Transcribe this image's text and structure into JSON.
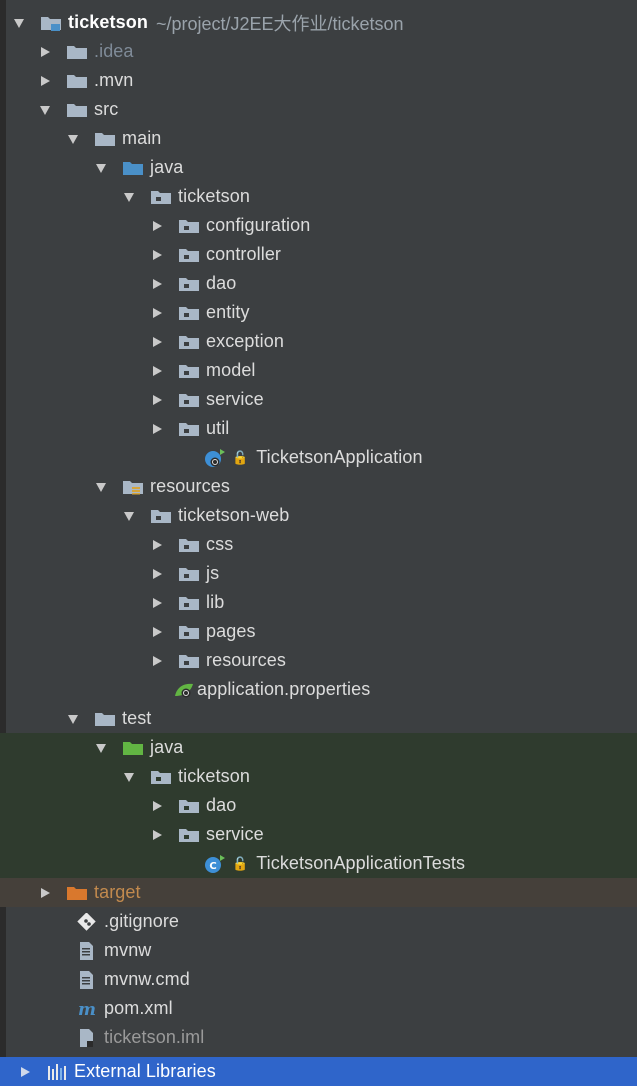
{
  "project": {
    "name": "ticketson",
    "path": "~/project/J2EE大作业/ticketson"
  },
  "tree": {
    "idea": ".idea",
    "mvn": ".mvn",
    "src": "src",
    "main": "main",
    "main_java": "java",
    "main_pkg": "ticketson",
    "configuration": "configuration",
    "controller": "controller",
    "dao": "dao",
    "entity": "entity",
    "exception": "exception",
    "model": "model",
    "service": "service",
    "util": "util",
    "app_class": "TicketsonApplication",
    "resources": "resources",
    "web": "ticketson-web",
    "css": "css",
    "js": "js",
    "lib": "lib",
    "pages": "pages",
    "web_resources": "resources",
    "app_props": "application.properties",
    "test": "test",
    "test_java": "java",
    "test_pkg": "ticketson",
    "test_dao": "dao",
    "test_service": "service",
    "test_class": "TicketsonApplicationTests",
    "target": "target",
    "gitignore": ".gitignore",
    "mvnw": "mvnw",
    "mvnw_cmd": "mvnw.cmd",
    "pom": "pom.xml",
    "iml": "ticketson.iml",
    "external_libraries": "External Libraries"
  },
  "colors": {
    "background": "#3c3f41",
    "test_highlight": "#2f3b2e",
    "excluded_highlight": "#45403a",
    "selection": "#2f65ca",
    "folder": "#a9b7c6",
    "source_folder": "#4a90c8",
    "test_folder": "#62b543",
    "excluded_folder": "#d9782d"
  },
  "icons": {
    "expanded": "triangle-down-icon",
    "collapsed": "triangle-right-icon",
    "folder": "folder-icon",
    "package": "package-icon",
    "spring_class": "spring-class-icon",
    "properties": "spring-properties-icon",
    "git": "git-icon",
    "file": "text-file-icon",
    "maven": "maven-icon",
    "iml": "iml-file-icon",
    "libraries": "libraries-icon"
  }
}
